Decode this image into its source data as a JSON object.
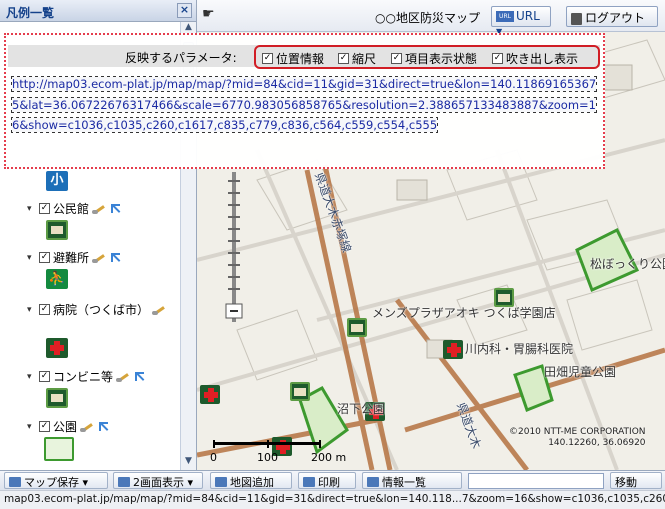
{
  "legend": {
    "title": "凡例一覧",
    "close_glyph": "×",
    "partial_top_label": "小",
    "items": [
      {
        "label": "公民館",
        "checked": true,
        "icon": "community-hall-icon"
      },
      {
        "label": "避難所",
        "checked": true,
        "icon": "evacuation-shelter-icon"
      },
      {
        "label": "病院（つくば市）",
        "checked": true,
        "icon": "hospital-icon"
      },
      {
        "label": "コンビニ等",
        "checked": true,
        "icon": "convenience-store-icon"
      },
      {
        "label": "公園",
        "checked": true,
        "icon": "park-icon"
      }
    ]
  },
  "toolbar": {
    "map_title": "○○地区防災マップ",
    "url_button": "URL",
    "url_badge": "URL",
    "logout_button": "ログアウト"
  },
  "url_popup": {
    "param_label": "反映するパラメータ:",
    "params": [
      {
        "label": "位置情報",
        "checked": true
      },
      {
        "label": "縮尺",
        "checked": true
      },
      {
        "label": "項目表示状態",
        "checked": true
      },
      {
        "label": "吹き出し表示",
        "checked": true
      }
    ],
    "url": "http://map03.ecom-plat.jp/map/map/?mid=84&cid=11&gid=31&direct=true&lon=140.118691653675&lat=36.06722676317466&scale=6770.983056858765&resolution=2.388657133483887&zoom=16&show=c1036,c1035,c260,c1617,c835,c779,c836,c564,c559,c554,c555"
  },
  "map": {
    "labels": {
      "road_top": "県道大木赤塚線",
      "road_bottom": "県道大木",
      "plaza": "メンズプラザアオキ つくば学園店",
      "clinic": "川内科・胃腸科医院",
      "nursery": "田畑児童公園",
      "park_small": "松ぼっくり公園",
      "park_center": "沼下公園"
    },
    "copyright": "©2010 NTT-ME CORPORATION",
    "coords": "140.12260, 36.06920",
    "scale_labels": [
      "0",
      "100",
      "200 m"
    ],
    "colors": {
      "park_border": "#3d9a2f",
      "road": "#b8794a",
      "hospital_cross": "#e01f24"
    }
  },
  "bottom_bar": {
    "save_map": "マップ保存",
    "two_screen": "2画面表示",
    "add_map": "地図追加",
    "print": "印刷",
    "info_list": "情報一覧",
    "move": "移動",
    "search_value": ""
  },
  "status_url": "map03.ecom-plat.jp/map/map/?mid=84&cid=11&gid=31&direct=true&lon=140.118...7&zoom=16&show=c1036,c1035,c260,c1617,c835,c"
}
